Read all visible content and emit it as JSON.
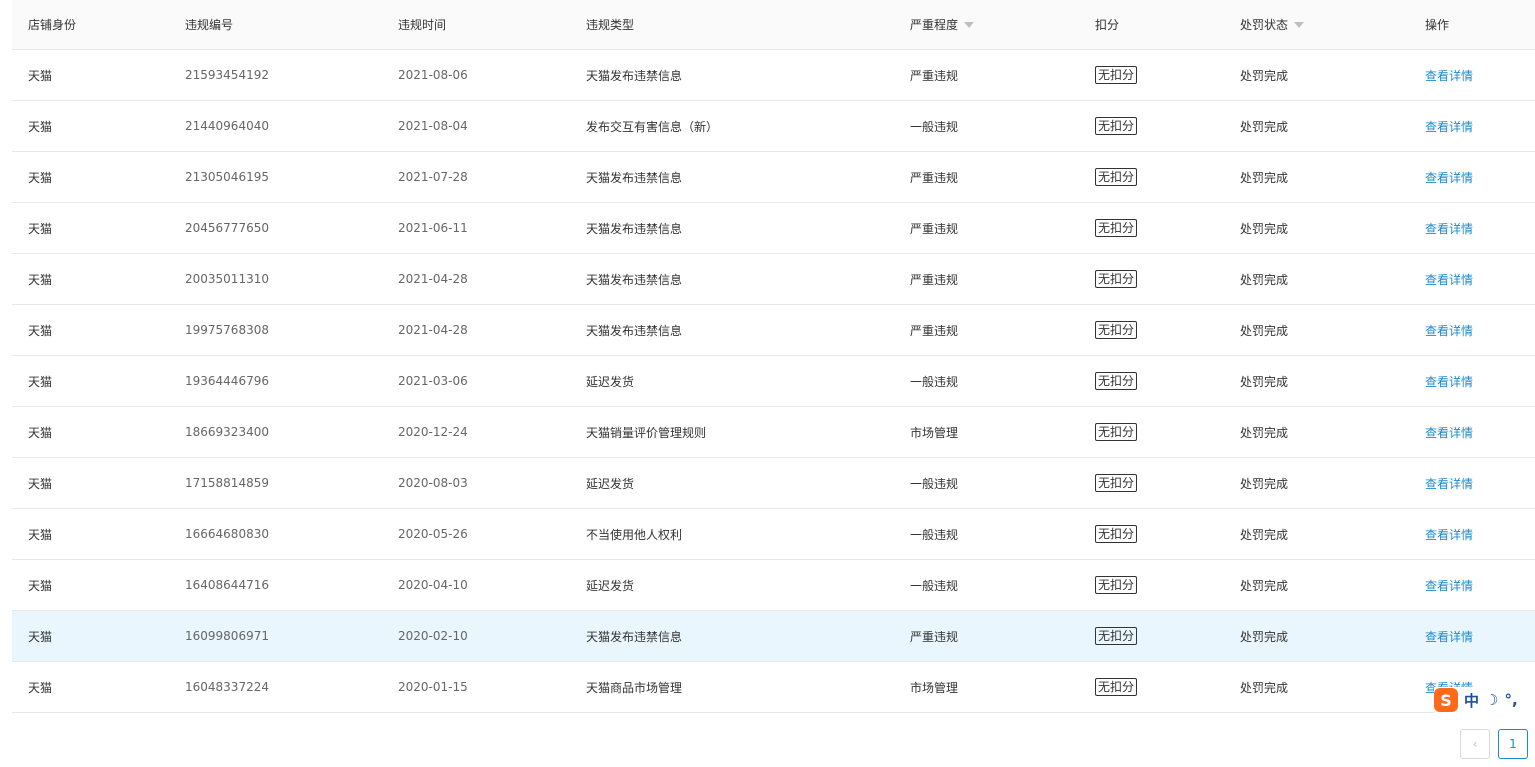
{
  "table": {
    "headers": {
      "shop_identity": "店铺身份",
      "violation_no": "违规编号",
      "violation_time": "违规时间",
      "violation_type": "违规类型",
      "severity": "严重程度",
      "deduction": "扣分",
      "penalty_status": "处罚状态",
      "action": "操作"
    },
    "rows": [
      {
        "shop": "天猫",
        "id": "21593454192",
        "date": "2021-08-06",
        "type": "天猫发布违禁信息",
        "severity": "严重违规",
        "deduction": "无扣分",
        "status": "处罚完成",
        "action": "查看详情"
      },
      {
        "shop": "天猫",
        "id": "21440964040",
        "date": "2021-08-04",
        "type": "发布交互有害信息（新）",
        "severity": "一般违规",
        "deduction": "无扣分",
        "status": "处罚完成",
        "action": "查看详情"
      },
      {
        "shop": "天猫",
        "id": "21305046195",
        "date": "2021-07-28",
        "type": "天猫发布违禁信息",
        "severity": "严重违规",
        "deduction": "无扣分",
        "status": "处罚完成",
        "action": "查看详情"
      },
      {
        "shop": "天猫",
        "id": "20456777650",
        "date": "2021-06-11",
        "type": "天猫发布违禁信息",
        "severity": "严重违规",
        "deduction": "无扣分",
        "status": "处罚完成",
        "action": "查看详情"
      },
      {
        "shop": "天猫",
        "id": "20035011310",
        "date": "2021-04-28",
        "type": "天猫发布违禁信息",
        "severity": "严重违规",
        "deduction": "无扣分",
        "status": "处罚完成",
        "action": "查看详情"
      },
      {
        "shop": "天猫",
        "id": "19975768308",
        "date": "2021-04-28",
        "type": "天猫发布违禁信息",
        "severity": "严重违规",
        "deduction": "无扣分",
        "status": "处罚完成",
        "action": "查看详情"
      },
      {
        "shop": "天猫",
        "id": "19364446796",
        "date": "2021-03-06",
        "type": "延迟发货",
        "severity": "一般违规",
        "deduction": "无扣分",
        "status": "处罚完成",
        "action": "查看详情"
      },
      {
        "shop": "天猫",
        "id": "18669323400",
        "date": "2020-12-24",
        "type": "天猫销量评价管理规则",
        "severity": "市场管理",
        "deduction": "无扣分",
        "status": "处罚完成",
        "action": "查看详情"
      },
      {
        "shop": "天猫",
        "id": "17158814859",
        "date": "2020-08-03",
        "type": "延迟发货",
        "severity": "一般违规",
        "deduction": "无扣分",
        "status": "处罚完成",
        "action": "查看详情"
      },
      {
        "shop": "天猫",
        "id": "16664680830",
        "date": "2020-05-26",
        "type": "不当使用他人权利",
        "severity": "一般违规",
        "deduction": "无扣分",
        "status": "处罚完成",
        "action": "查看详情"
      },
      {
        "shop": "天猫",
        "id": "16408644716",
        "date": "2020-04-10",
        "type": "延迟发货",
        "severity": "一般违规",
        "deduction": "无扣分",
        "status": "处罚完成",
        "action": "查看详情"
      },
      {
        "shop": "天猫",
        "id": "16099806971",
        "date": "2020-02-10",
        "type": "天猫发布违禁信息",
        "severity": "严重违规",
        "deduction": "无扣分",
        "status": "处罚完成",
        "action": "查看详情"
      },
      {
        "shop": "天猫",
        "id": "16048337224",
        "date": "2020-01-15",
        "type": "天猫商品市场管理",
        "severity": "市场管理",
        "deduction": "无扣分",
        "status": "处罚完成",
        "action": "查看详情"
      }
    ],
    "highlighted_row_index": 11
  },
  "pagination": {
    "prev_icon": "‹",
    "current_page": "1"
  },
  "ime_toolbar": {
    "logo": "S",
    "mode": "中",
    "moon_icon": "☽",
    "punct": "°,"
  },
  "colors": {
    "link": "#1f8ac9",
    "header_bg": "#fafafa",
    "highlight_bg": "#e9f6fd",
    "border": "#e8e8e8"
  }
}
